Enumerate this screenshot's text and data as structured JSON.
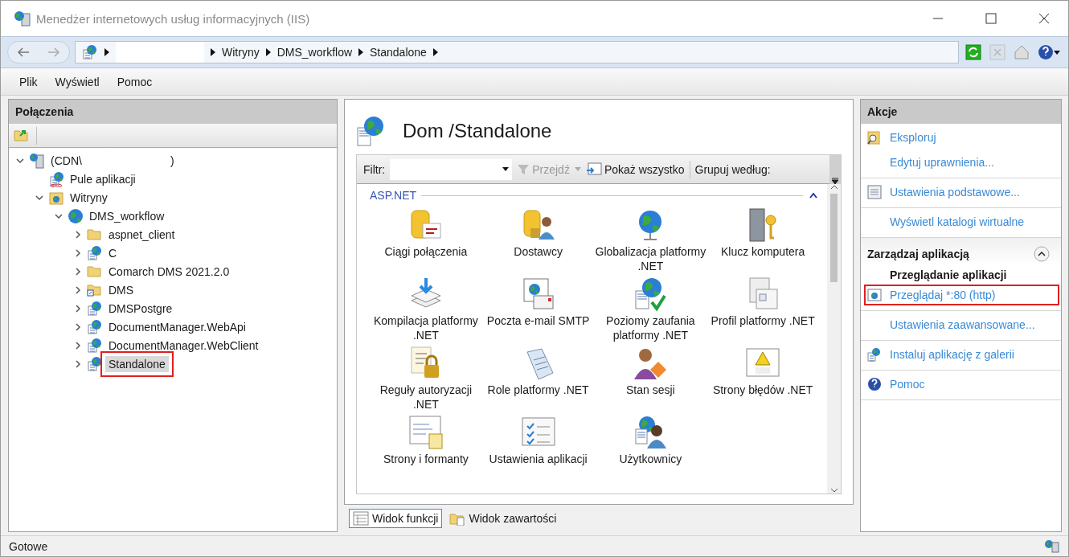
{
  "window": {
    "title": "Menedżer internetowych usług informacyjnych (IIS)"
  },
  "address_bar": {
    "breadcrumb": [
      "Witryny",
      "DMS_workflow",
      "Standalone"
    ]
  },
  "toolbar": {
    "stop_disabled": true
  },
  "menu": [
    "Plik",
    "Wyświetl",
    "Pomoc"
  ],
  "connections": {
    "title": "Połączenia",
    "tree": [
      {
        "kind": "server",
        "label": "(CDN\\",
        "label_end": ")",
        "expanded": true,
        "selected": false,
        "highlighted": false,
        "children": [
          {
            "kind": "pools",
            "label": "Pule aplikacji",
            "selected": false,
            "highlighted": false
          },
          {
            "kind": "sites",
            "label": "Witryny",
            "expanded": true,
            "selected": false,
            "highlighted": false,
            "children": [
              {
                "kind": "site",
                "label": "DMS_workflow",
                "expanded": true,
                "selected": false,
                "highlighted": false,
                "children": [
                  {
                    "kind": "folder",
                    "label": "aspnet_client",
                    "expanded": false,
                    "selected": false,
                    "highlighted": false
                  },
                  {
                    "kind": "app",
                    "label": "C",
                    "expanded": false,
                    "selected": false,
                    "highlighted": false
                  },
                  {
                    "kind": "folder",
                    "label": "Comarch DMS 2021.2.0",
                    "expanded": false,
                    "selected": false,
                    "highlighted": false
                  },
                  {
                    "kind": "vdir",
                    "label": "DMS",
                    "expanded": false,
                    "selected": false,
                    "highlighted": false
                  },
                  {
                    "kind": "app",
                    "label": "DMSPostgre",
                    "expanded": false,
                    "selected": false,
                    "highlighted": false
                  },
                  {
                    "kind": "app",
                    "label": "DocumentManager.WebApi",
                    "expanded": false,
                    "selected": false,
                    "highlighted": false
                  },
                  {
                    "kind": "app",
                    "label": "DocumentManager.WebClient",
                    "expanded": false,
                    "selected": false,
                    "highlighted": false
                  },
                  {
                    "kind": "app",
                    "label": "Standalone",
                    "expanded": false,
                    "selected": true,
                    "highlighted": true
                  }
                ]
              }
            ]
          }
        ]
      }
    ]
  },
  "content": {
    "title": "Dom /Standalone",
    "filter": {
      "label": "Filtr:",
      "go": "Przejdź",
      "go_disabled": true,
      "show_all": "Pokaż wszystko",
      "group_by": "Grupuj według:"
    },
    "group": {
      "title": "ASP.NET",
      "expanded": true
    },
    "features": [
      {
        "kind": "db-text",
        "label": "Ciągi połączenia"
      },
      {
        "kind": "db-user",
        "label": "Dostawcy"
      },
      {
        "kind": "globe",
        "label": "Globalizacja platformy .NET"
      },
      {
        "kind": "server-key",
        "label": "Klucz komputera"
      },
      {
        "kind": "download",
        "label": "Kompilacja platformy .NET"
      },
      {
        "kind": "mail",
        "label": "Poczta e-mail SMTP"
      },
      {
        "kind": "globe-check",
        "label": "Poziomy zaufania platformy .NET"
      },
      {
        "kind": "windows",
        "label": "Profil platformy .NET"
      },
      {
        "kind": "doc-lock",
        "label": "Reguły autoryzacji .NET"
      },
      {
        "kind": "tag",
        "label": "Role platformy .NET"
      },
      {
        "kind": "user-diamond",
        "label": "Stan sesji"
      },
      {
        "kind": "warning",
        "label": "Strony błędów .NET"
      },
      {
        "kind": "form",
        "label": "Strony i formanty"
      },
      {
        "kind": "checklist",
        "label": "Ustawienia aplikacji"
      },
      {
        "kind": "users",
        "label": "Użytkownicy"
      }
    ],
    "views": [
      {
        "label": "Widok funkcji",
        "selected": true
      },
      {
        "label": "Widok zawartości",
        "selected": false
      }
    ]
  },
  "actions": {
    "title": "Akcje",
    "sections": [
      [
        {
          "kind": "explore",
          "label": "Eksploruj",
          "highlighted": false
        },
        {
          "kind": "plain",
          "label": "Edytuj uprawnienia...",
          "highlighted": false
        }
      ],
      [
        {
          "kind": "settings",
          "label": "Ustawienia podstawowe...",
          "highlighted": false
        }
      ],
      [
        {
          "kind": "plain",
          "label": "Wyświetl katalogi wirtualne",
          "highlighted": false
        }
      ]
    ],
    "group": {
      "title": "Zarządzaj aplikacją",
      "expanded": true,
      "subtitle": "Przeglądanie aplikacji",
      "sections": [
        [
          {
            "kind": "browse",
            "label": "Przeglądaj *:80 (http)",
            "highlighted": true
          }
        ],
        [
          {
            "kind": "plain",
            "label": "Ustawienia zaawansowane...",
            "highlighted": false
          }
        ],
        [
          {
            "kind": "gallery",
            "label": "Instaluj aplikację z galerii",
            "highlighted": false
          }
        ],
        [
          {
            "kind": "help",
            "label": "Pomoc",
            "highlighted": false
          }
        ]
      ]
    }
  },
  "status_bar": {
    "text": "Gotowe"
  }
}
